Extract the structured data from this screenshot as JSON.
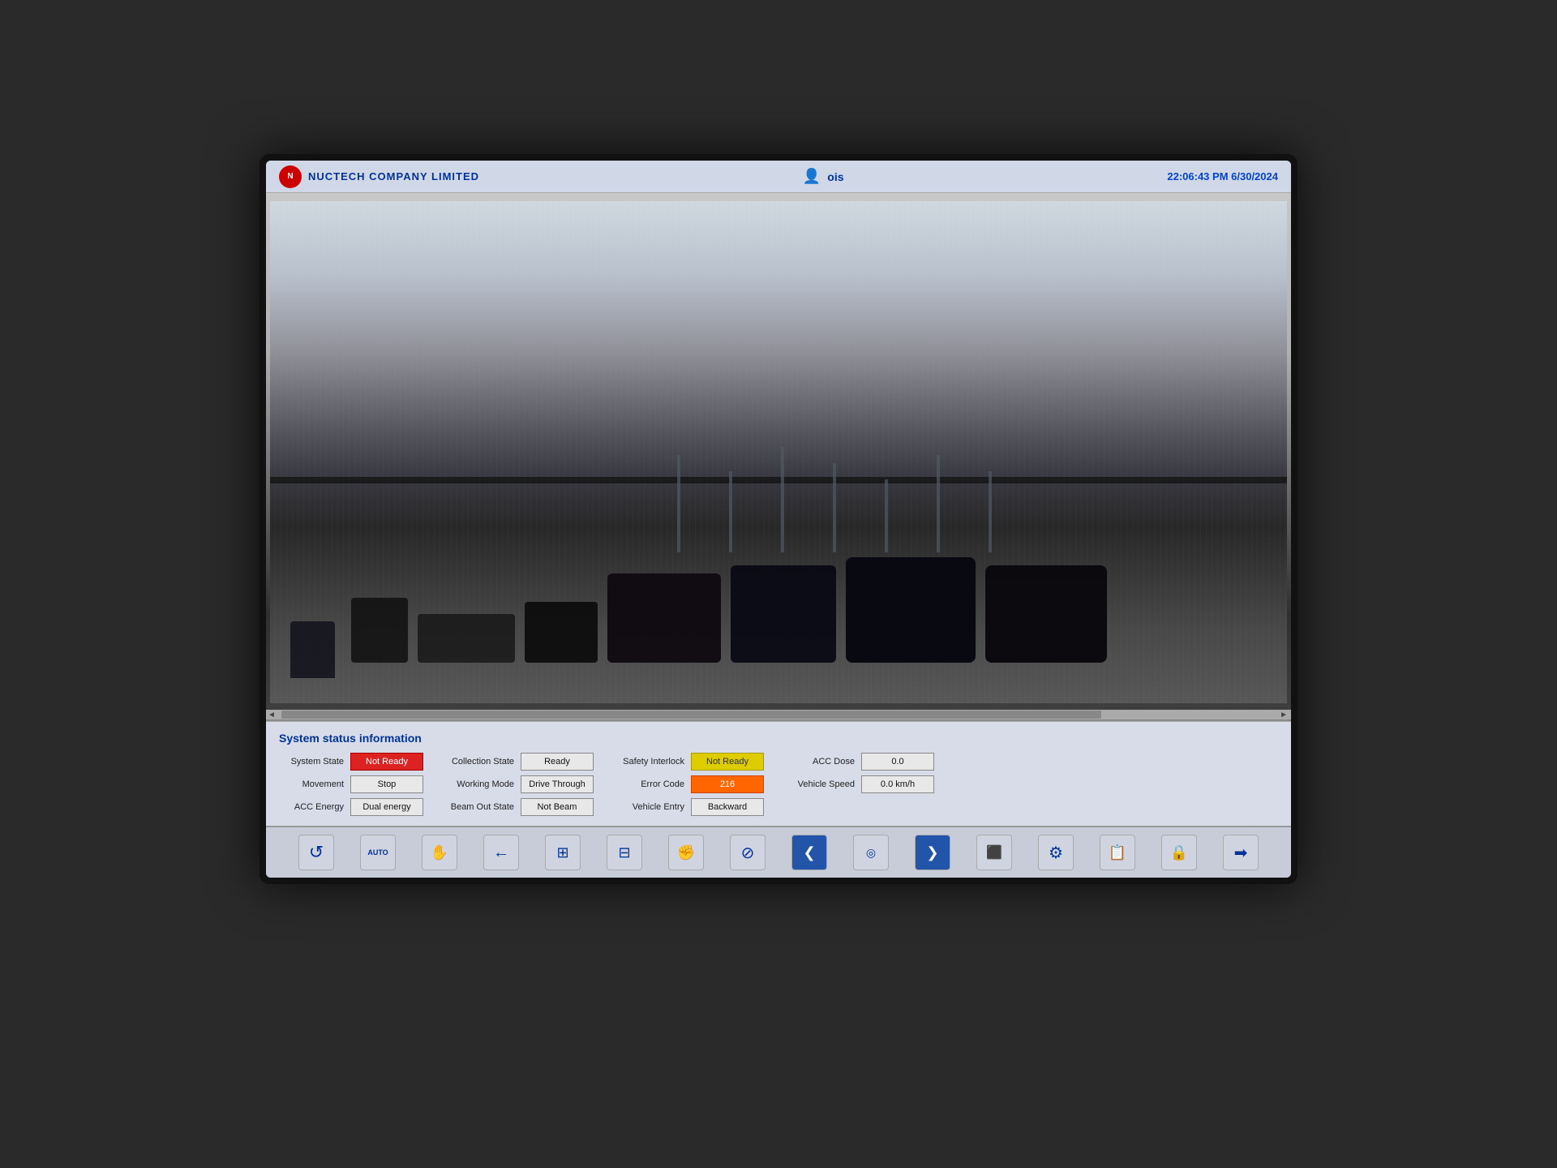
{
  "app": {
    "company": "NUCTECH COMPANY LIMITED",
    "user": "ois",
    "datetime": "22:06:43 PM 6/30/2024"
  },
  "xray": {
    "scroll_left": "◄",
    "scroll_right": "►"
  },
  "status": {
    "title": "System status information",
    "rows": [
      {
        "col1_label": "System State",
        "col1_value": "Not Ready",
        "col1_style": "red-bg",
        "col2_label": "Collection State",
        "col2_value": "Ready",
        "col2_style": "",
        "col3_label": "Safety Interlock",
        "col3_value": "Not Ready",
        "col3_style": "yellow-bg",
        "col4_label": "ACC Dose",
        "col4_value": "0.0",
        "col4_style": ""
      },
      {
        "col1_label": "Movement",
        "col1_value": "Stop",
        "col1_style": "",
        "col2_label": "Working Mode",
        "col2_value": "Drive Through",
        "col2_style": "",
        "col3_label": "Error Code",
        "col3_value": "216",
        "col3_style": "orange-bg",
        "col4_label": "Vehicle Speed",
        "col4_value": "0.0 km/h",
        "col4_style": ""
      },
      {
        "col1_label": "ACC Energy",
        "col1_value": "Dual energy",
        "col1_style": "",
        "col2_label": "Beam Out State",
        "col2_value": "Not Beam",
        "col2_style": "",
        "col3_label": "Vehicle Entry",
        "col3_value": "Backward",
        "col3_style": "",
        "col4_label": "",
        "col4_value": "",
        "col4_style": ""
      }
    ]
  },
  "toolbar": {
    "buttons": [
      {
        "name": "reset-button",
        "icon": "↺",
        "label": "Reset"
      },
      {
        "name": "auto-button",
        "icon": "AUTO",
        "label": "Auto",
        "small": true
      },
      {
        "name": "hand-button",
        "icon": "✋",
        "label": "Manual"
      },
      {
        "name": "back-button",
        "icon": "←",
        "label": "Back"
      },
      {
        "name": "gate1-button",
        "icon": "⊞",
        "label": "Gate 1"
      },
      {
        "name": "gate2-button",
        "icon": "⊟",
        "label": "Gate 2"
      },
      {
        "name": "stop-button",
        "icon": "✊",
        "label": "Stop"
      },
      {
        "name": "cancel-button",
        "icon": "⊘",
        "label": "Cancel"
      },
      {
        "name": "prev-button",
        "icon": "❮",
        "label": "Previous"
      },
      {
        "name": "scan-button",
        "icon": "◎",
        "label": "Scan"
      },
      {
        "name": "next-button",
        "icon": "❯",
        "label": "Next"
      },
      {
        "name": "image-button",
        "icon": "⬛",
        "label": "Image"
      },
      {
        "name": "settings-button",
        "icon": "⚙",
        "label": "Settings"
      },
      {
        "name": "report-button",
        "icon": "📋",
        "label": "Report"
      },
      {
        "name": "lock-button",
        "icon": "🔒",
        "label": "Lock"
      },
      {
        "name": "exit-button",
        "icon": "➡",
        "label": "Exit"
      }
    ]
  }
}
